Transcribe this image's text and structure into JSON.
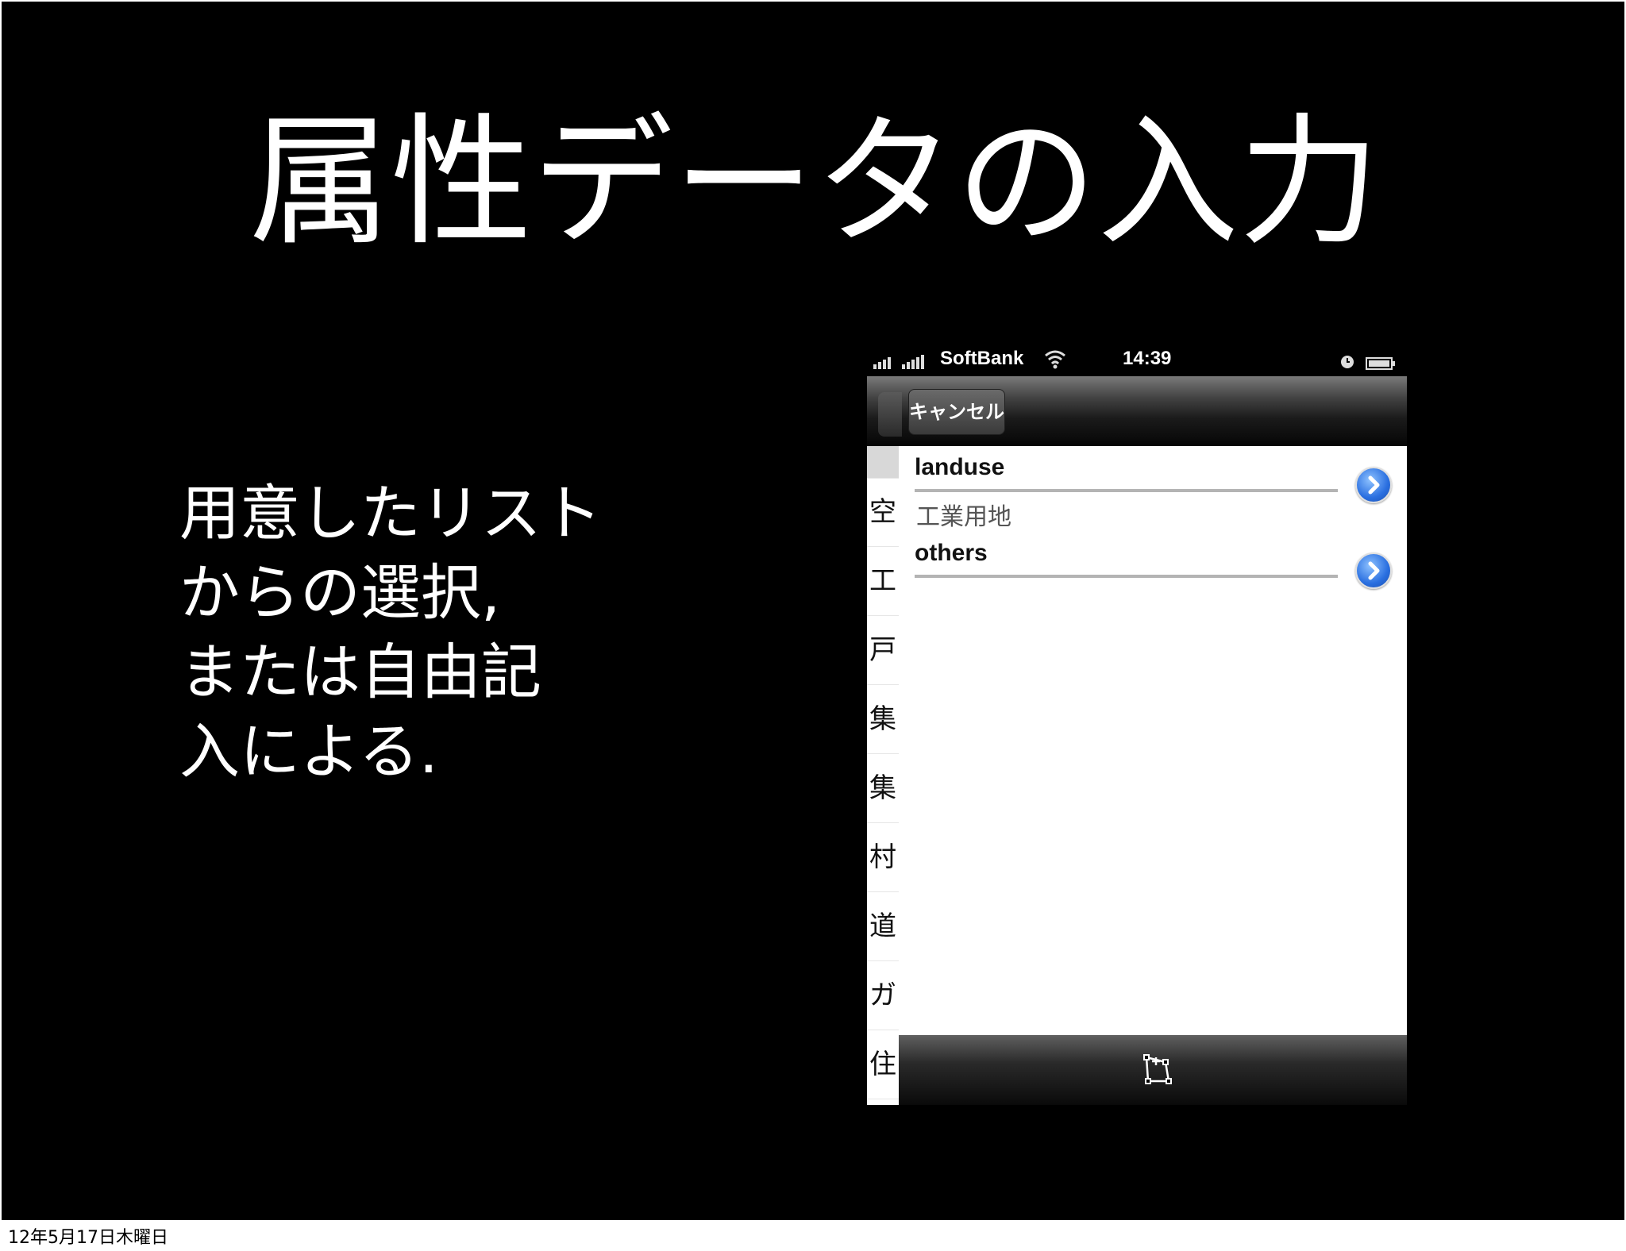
{
  "slide": {
    "title": "属性データの入力",
    "body_lines": [
      "用意したリスト",
      "からの選択,",
      "または自由記",
      "入による."
    ]
  },
  "phone": {
    "status_bar": {
      "carrier": "SoftBank",
      "time": "14:39"
    },
    "nav_bar": {
      "cancel_label": "キャンセル"
    },
    "fields": [
      {
        "label": "landuse",
        "value": "工業用地"
      },
      {
        "label": "others",
        "value": ""
      }
    ],
    "background_list": [
      "空",
      "工",
      "戸",
      "集",
      "集",
      "村",
      "道",
      "ガ",
      "住"
    ],
    "toolbar": {
      "icon": "draw-polygon-icon"
    }
  },
  "footer": {
    "date": "12年5月17日木曜日"
  },
  "colors": {
    "slide_bg": "#000000",
    "text": "#ffffff",
    "disclosure": "#2a6fe0"
  }
}
